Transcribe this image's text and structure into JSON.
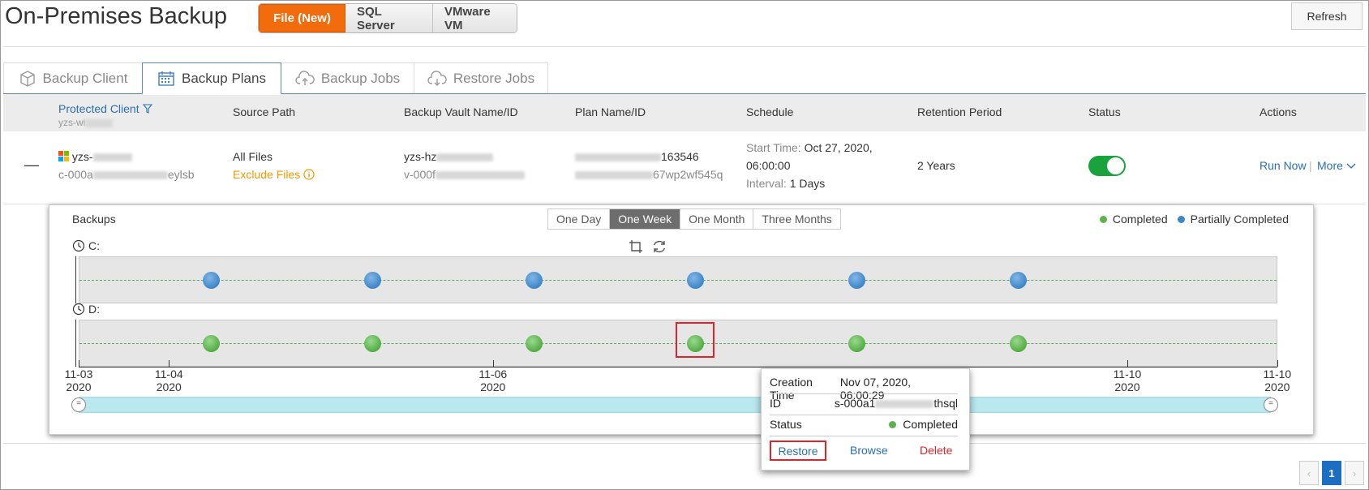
{
  "header": {
    "title": "On-Premises Backup",
    "types": [
      {
        "label": "File (New)",
        "active": true
      },
      {
        "label": "SQL Server",
        "active": false
      },
      {
        "label": "VMware VM",
        "active": false
      }
    ],
    "refresh_label": "Refresh"
  },
  "tabs": [
    {
      "label": "Backup Client",
      "icon": "cube-icon"
    },
    {
      "label": "Backup Plans",
      "icon": "calendar-icon",
      "active": true
    },
    {
      "label": "Backup Jobs",
      "icon": "cloud-upload-icon"
    },
    {
      "label": "Restore Jobs",
      "icon": "cloud-download-icon"
    }
  ],
  "table": {
    "columns": {
      "protected_client": "Protected Client",
      "protected_client_sub": "yzs-wi",
      "source_path": "Source Path",
      "vault": "Backup Vault Name/ID",
      "plan": "Plan Name/ID",
      "schedule": "Schedule",
      "retention": "Retention Period",
      "status": "Status",
      "actions": "Actions"
    },
    "row": {
      "collapse_symbol": "—",
      "client_name": "yzs-",
      "client_id": "c-000a",
      "client_id_tail": "eylsb",
      "source_path": "All Files",
      "exclude_files": "Exclude Files",
      "vault_name": "yzs-hz",
      "vault_id": "v-000f",
      "plan_name_tail": "163546",
      "plan_id_tail": "67wp2wf545q",
      "schedule_start_label": "Start Time:",
      "schedule_start_value": "Oct 27, 2020,",
      "schedule_time": "06:00:00",
      "schedule_interval_label": "Interval:",
      "schedule_interval_value": "1 Days",
      "retention": "2 Years",
      "status_enabled": true,
      "run_now": "Run Now",
      "more": "More"
    }
  },
  "backups_panel": {
    "title": "Backups",
    "ranges": [
      {
        "label": "One Day",
        "active": false
      },
      {
        "label": "One Week",
        "active": true
      },
      {
        "label": "One Month",
        "active": false
      },
      {
        "label": "Three Months",
        "active": false
      }
    ],
    "legend": [
      {
        "label": "Completed",
        "color": "#5cb34c"
      },
      {
        "label": "Partially Completed",
        "color": "#3d86c8"
      }
    ],
    "x_axis_range": [
      "2020-11-03",
      "2020-11-10"
    ],
    "tick_labels": [
      {
        "date": "11-03",
        "year": "2020",
        "at": 0.0
      },
      {
        "date": "11-04",
        "year": "2020",
        "at": 0.0753
      },
      {
        "date": "11-06",
        "year": "2020",
        "at": 0.3456
      },
      {
        "date": "11-10",
        "year": "2020",
        "at": 0.8748
      },
      {
        "date": "11-10",
        "year": "2020",
        "at": 0.9999
      }
    ],
    "series": [
      {
        "name": "C:",
        "status": "Partially Completed",
        "color": "blue",
        "points": [
          0.1096,
          0.244,
          0.379,
          0.5136,
          0.6482,
          0.7828
        ]
      },
      {
        "name": "D:",
        "status": "Completed",
        "color": "green",
        "points": [
          0.1096,
          0.244,
          0.379,
          0.5136,
          0.6482,
          0.7828
        ],
        "selected_index": 3
      }
    ]
  },
  "tooltip": {
    "creation_time_label": "Creation Time",
    "creation_time_value": "Nov 07, 2020, 06:00:29",
    "id_label": "ID",
    "id_value_head": "s-000a1",
    "id_value_tail": "thsql",
    "status_label": "Status",
    "status_value": "Completed",
    "restore": "Restore",
    "browse": "Browse",
    "delete": "Delete"
  },
  "pagination": {
    "current": "1",
    "prev": "‹",
    "next": "›"
  }
}
